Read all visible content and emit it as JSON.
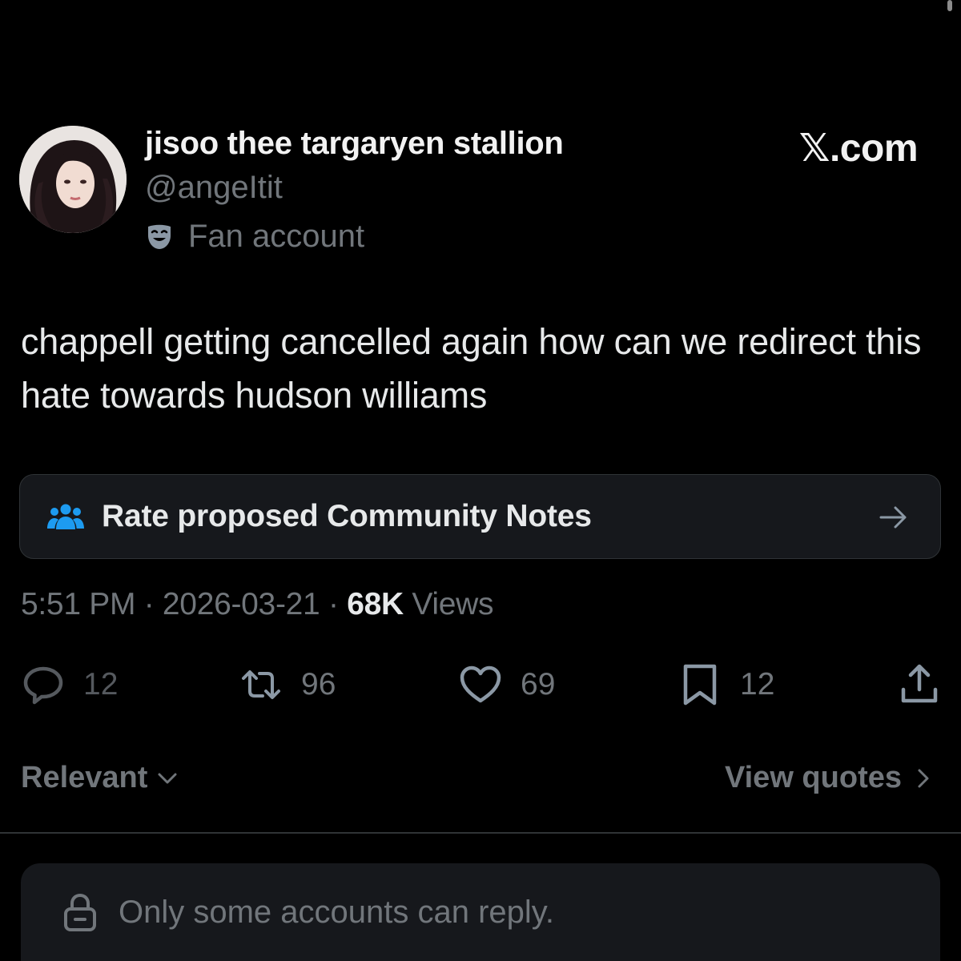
{
  "author": {
    "display_name": "jisoo thee targaryen stallion",
    "handle": "@angeItit",
    "label": "Fan account"
  },
  "brand": "𝕏.com",
  "tweet": {
    "text": "chappell getting cancelled again how can we redirect this hate towards hudson williams"
  },
  "community_notes": {
    "label": "Rate proposed Community Notes"
  },
  "meta": {
    "time": "5:51 PM",
    "separator": " · ",
    "date": "2026-03-21",
    "views_count": "68K",
    "views_label": " Views"
  },
  "actions": {
    "replies": "12",
    "reposts": "96",
    "likes": "69",
    "bookmarks": "12"
  },
  "replies_section": {
    "sort_label": "Relevant",
    "quotes_label": "View quotes"
  },
  "reply_bar": {
    "text": "Only some accounts can reply."
  },
  "colors": {
    "background": "#000000",
    "text_primary": "#e7e9ea",
    "text_secondary": "#71767b",
    "card_bg": "#16181c",
    "border": "#2f3336",
    "community_notes_icon": "#1d9bf0",
    "fan_mask": "#8b98a5"
  },
  "icons": {
    "fan": "theater-mask-icon",
    "notes": "people-icon",
    "notes_arrow": "arrow-right-icon",
    "reply": "speech-bubble-icon",
    "repost": "repost-icon",
    "like": "heart-icon",
    "bookmark": "bookmark-icon",
    "share": "share-icon",
    "sort": "chevron-down-icon",
    "quotes": "chevron-right-icon",
    "reply_bar": "lock-icon"
  }
}
